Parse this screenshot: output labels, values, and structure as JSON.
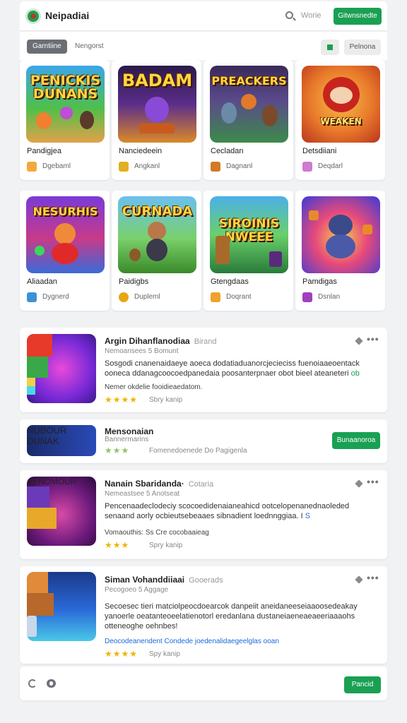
{
  "header": {
    "app_title": "Neipadiai",
    "search_label": "Worie",
    "action_button": "Gitwnsnedte",
    "logo_icon": "app-logo-icon"
  },
  "tabs": {
    "active": "Garntiine",
    "other": "Nengorst",
    "sort_button": "Pelnona",
    "filter_icon": "filter-icon"
  },
  "tiles": [
    {
      "art_text": "PENICKIS DUNANS",
      "name": "Pandigjea",
      "meta": "Dgebaml",
      "meta_icon": "plus-icon",
      "meta_color": "#f2a93b"
    },
    {
      "art_text": "BADAM",
      "name": "Nanciedeein",
      "meta": "Angkanl",
      "meta_icon": "gift-icon",
      "meta_color": "#e0b020"
    },
    {
      "art_text": "PREACKERS",
      "name": "Cecladan",
      "meta": "Dagnanl",
      "meta_icon": "box-icon",
      "meta_color": "#d27a26"
    },
    {
      "art_text": "WEAKEN",
      "name": "Detsdiiani",
      "meta": "Deqdarl",
      "meta_icon": "flower-icon",
      "meta_color": "#d07ad0"
    },
    {
      "art_text": "NESURHIS",
      "name": "Aliaadan",
      "meta": "Dygnerd",
      "meta_icon": "screen-icon",
      "meta_color": "#3c92d6"
    },
    {
      "art_text": "CURNADA",
      "name": "Paidigbs",
      "meta": "Dupleml",
      "meta_icon": "coin-icon",
      "meta_color": "#e8a515"
    },
    {
      "art_text": "SIROINIS NWEEE",
      "name": "Gtengdaas",
      "meta": "Doqrant",
      "meta_icon": "bird-icon",
      "meta_color": "#f0a22a"
    },
    {
      "art_text": "",
      "name": "Pamdigas",
      "meta": "Dsnlan",
      "meta_icon": "puzzle-icon",
      "meta_color": "#a23fc0"
    }
  ],
  "cards": [
    {
      "title": "Argin Dihanflanodiaa",
      "subtitle": "Birand",
      "meta": "Nemoansees 5 Bomunt",
      "desc": "Sosgodi cnanenaidaeye aoeca dodatiaduanorcjecieciss fuenoiaaeoentack ooneca ddanagcoocoedpanedaia poosanterpnaer obot bieel ateaneteri",
      "desc_accent": "ob",
      "extra": "Nemer okdelie fooidieaedatom.",
      "stars": "★★★★",
      "stars_note": "Sbry kanip"
    },
    {
      "art_text": "NUBOUR DUNAK",
      "title": "Mensonaian",
      "meta": "Bannermarins",
      "stars": "★★★",
      "stars_note": "Fomenedoenede Do Pagigenla",
      "button": "Bunaanoroa"
    },
    {
      "art_text": "VENOMOUR",
      "title": "Nanain Sbaridanda·",
      "subtitle": "Cotaria",
      "meta": "Nemeastsee 5 Anotseat",
      "desc": "Pencenaadeclodeciy scocoedidenaianeahicd ootcelopenanednaoleded senaand aorly ocbieutsebeaaes sibnadient loednnggiaa. I",
      "desc_accent": "S",
      "extra": "Vomaouthis: Ss Cre cocobaaieag",
      "stars": "★★★",
      "stars_note": "Spry kanip"
    },
    {
      "title": "Siman Vohanddiiaai",
      "subtitle": "Gooerads",
      "meta": "Pecogoeo 5 Aggage",
      "desc": "Secoesec tieri matciolpeocdoearcok danpeiit aneidaneeseiaaoosedeakay yanoerle oeatanteoeelatienotorl eredanlana dustaneiaeneaeaeeriaaaohs otteneoghe oehnbes!",
      "extra": "Deocodeanendent Condede joedenalidaegeelglas ooan",
      "stars": "★★★★",
      "stars_note": "Spy kanip"
    }
  ],
  "footer": {
    "button": "Pancid"
  },
  "colors": {
    "accent": "#1aa053",
    "star": "#f0b400"
  }
}
